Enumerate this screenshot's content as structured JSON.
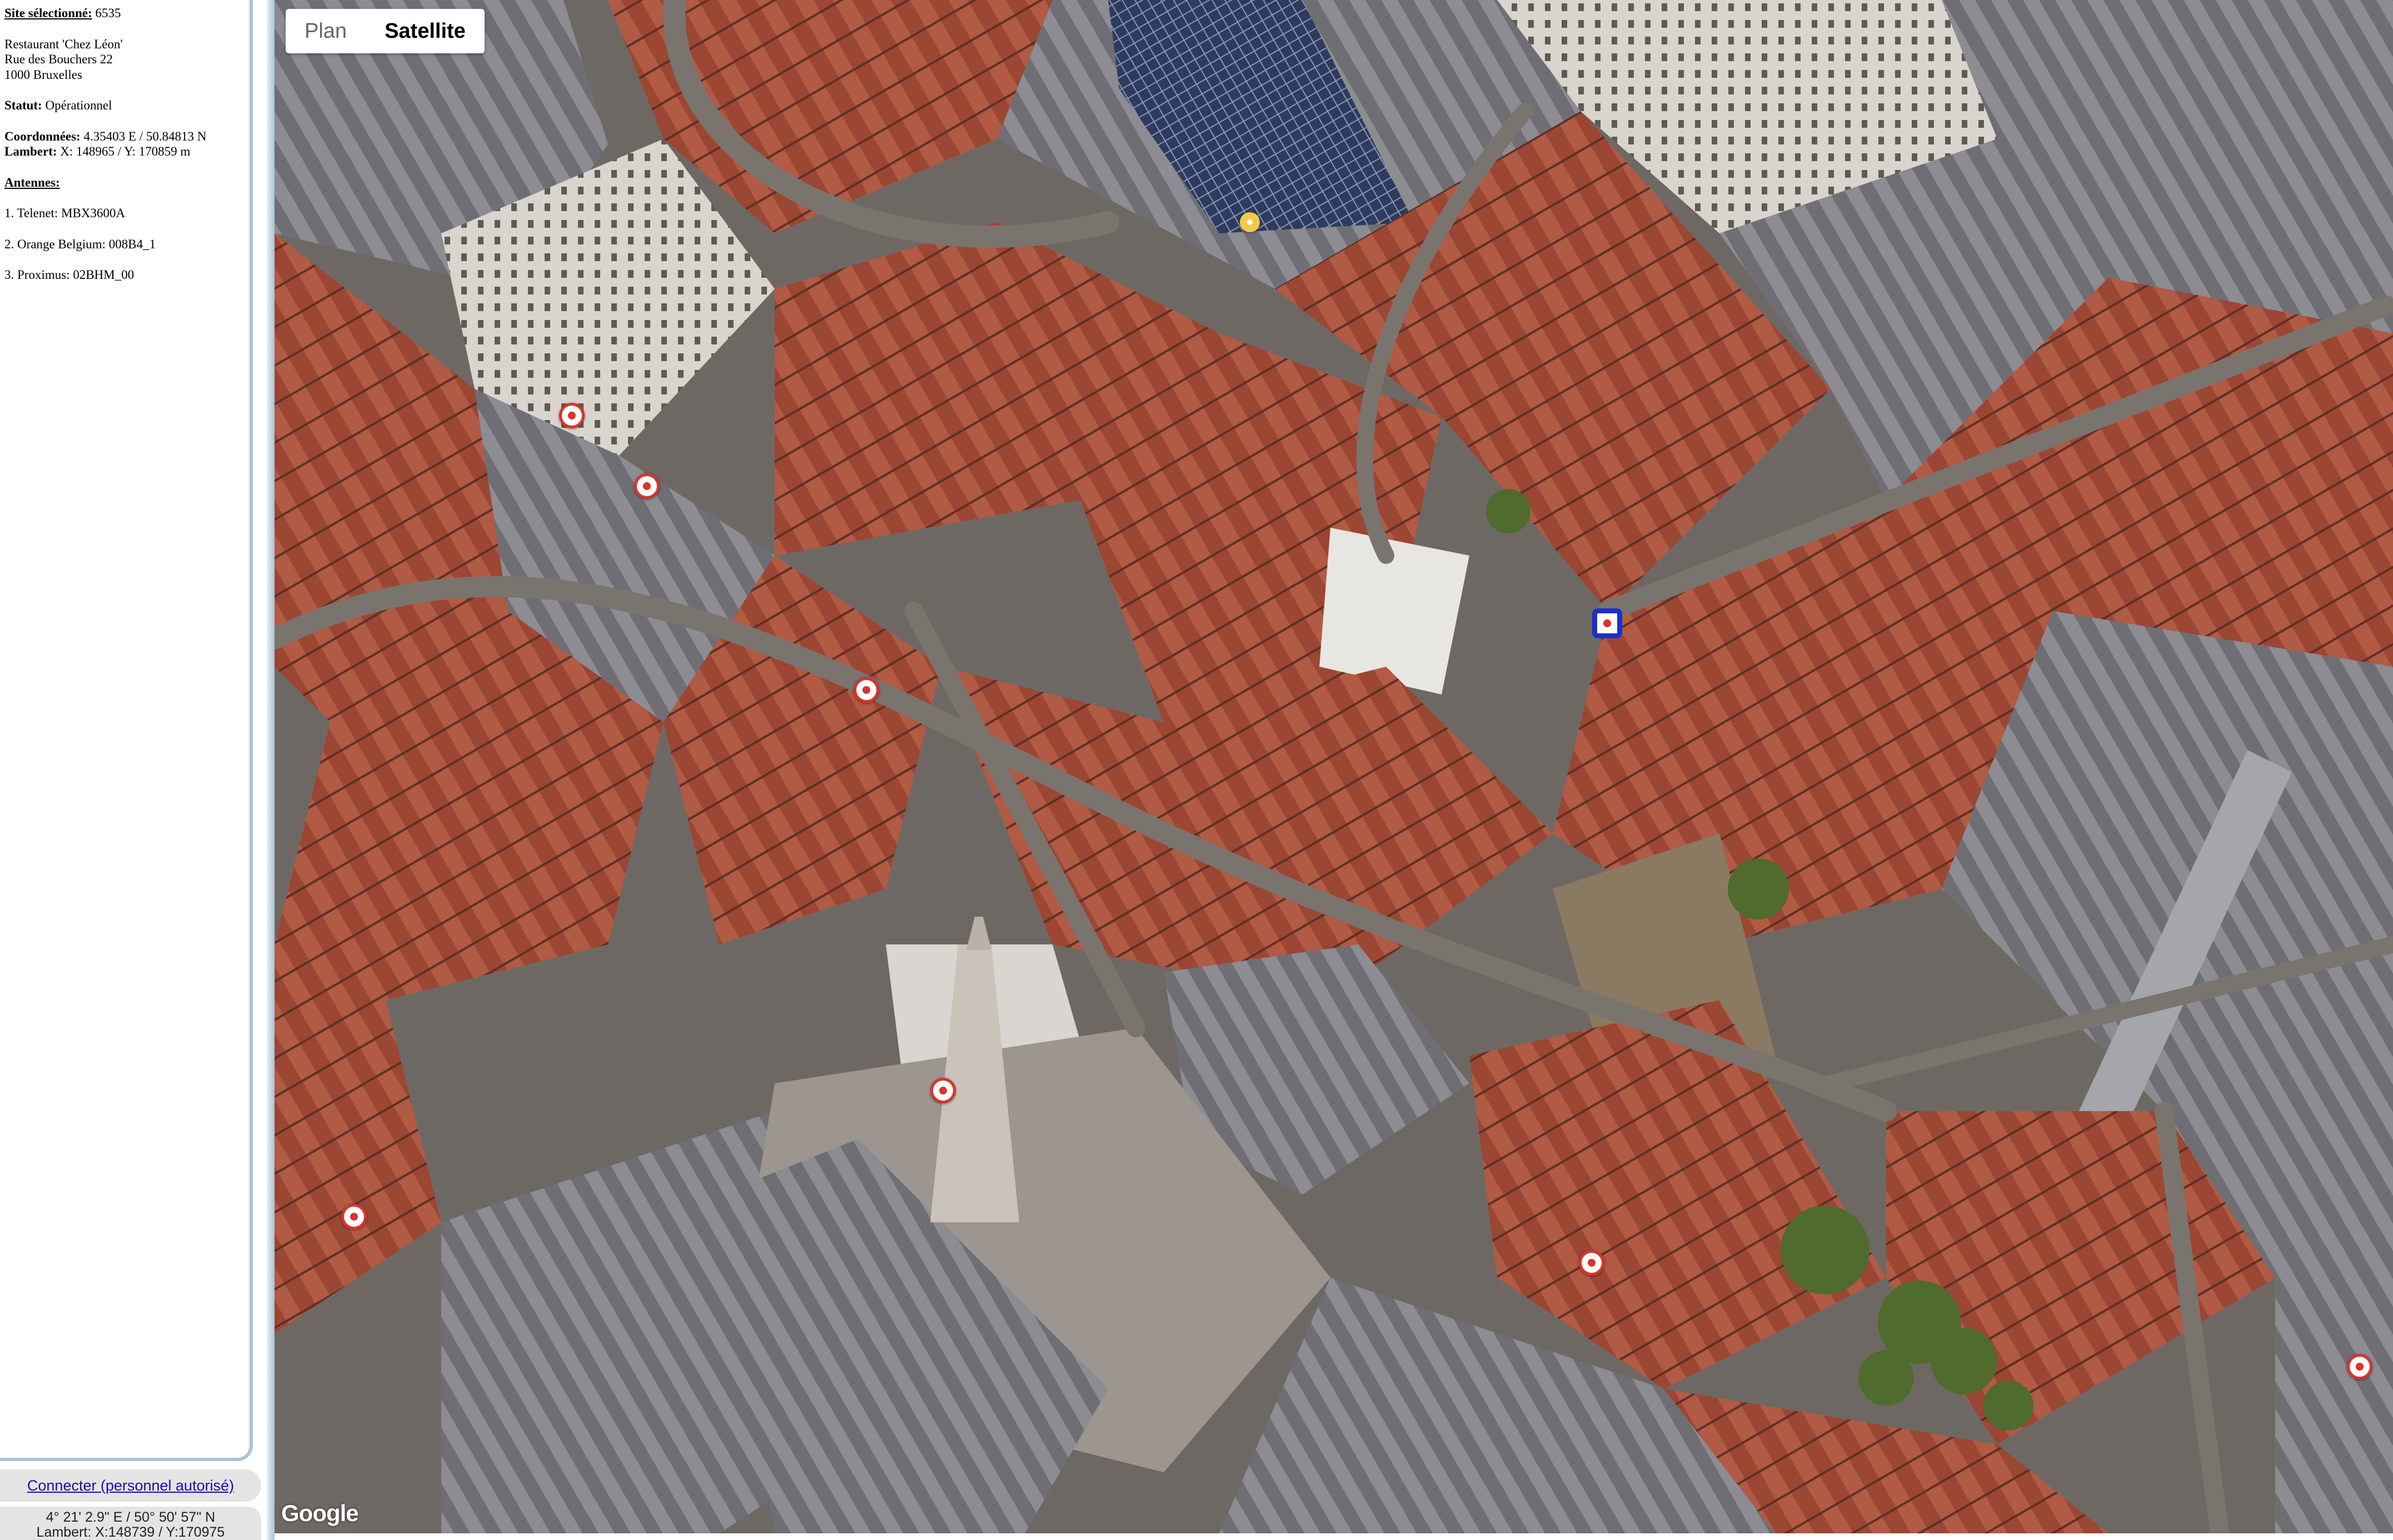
{
  "sidebar": {
    "site_label": "Site sélectionné:",
    "site_id": "6535",
    "address_line1": "Restaurant 'Chez Léon'",
    "address_line2": "Rue des Bouchers 22",
    "address_line3": "1000 Bruxelles",
    "status_label": "Statut:",
    "status_value": "Opérationnel",
    "coords_label": "Coordonnées:",
    "coords_value": "4.35403 E / 50.84813 N",
    "lambert_label": "Lambert:",
    "lambert_value": "X: 148965 / Y: 170859 m",
    "antennas_label": "Antennes:",
    "antennas": [
      "1. Telenet: MBX3600A",
      "2. Orange Belgium: 008B4_1",
      "3. Proximus: 02BHM_00"
    ],
    "connect_link": "Connecter (personnel autorisé)",
    "cursor_coords": "4° 21' 2.9\" E / 50° 50' 57\" N",
    "cursor_lambert": "Lambert: X:148739 / Y:170975"
  },
  "map": {
    "type_plan": "Plan",
    "type_satellite": "Satellite",
    "active_type": "Satellite",
    "logo": "Google",
    "colors": {
      "roof_red": "#b5533c",
      "roof_grey": "#8a8a8f",
      "street": "#7a746e",
      "plaza": "#9b9590",
      "tree": "#4f6b2e",
      "marker_red": "#d9342b",
      "marker_selected": "#1e2fc9"
    }
  }
}
